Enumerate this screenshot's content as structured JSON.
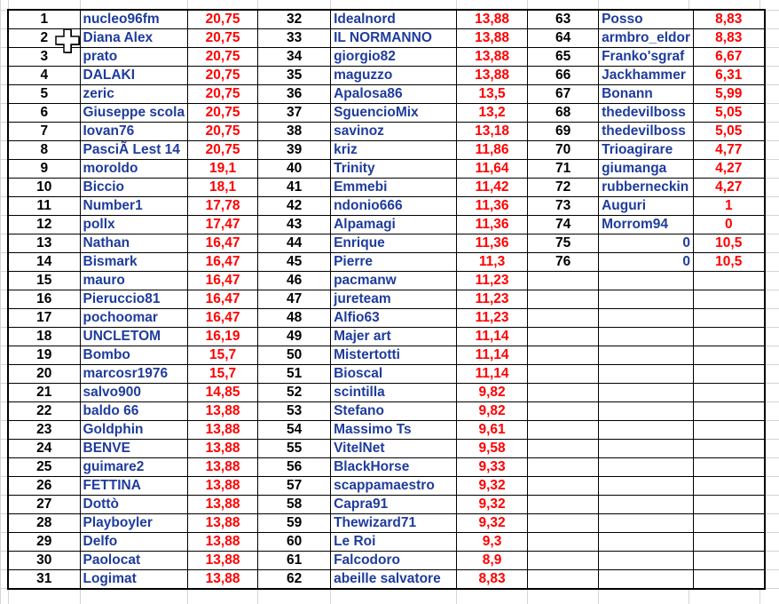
{
  "colors": {
    "rank": "#000000",
    "name": "#1f3c9c",
    "score": "#ff0000"
  },
  "cursor_icon": "excel-cell-select-cross-cursor",
  "groups": [
    [
      [
        "1",
        "nucleo96fm",
        "20,75"
      ],
      [
        "2",
        "Diana Alex",
        "20,75"
      ],
      [
        "3",
        "prato",
        "20,75"
      ],
      [
        "4",
        "DALAKI",
        "20,75"
      ],
      [
        "5",
        "zeric",
        "20,75"
      ],
      [
        "6",
        "Giuseppe scola",
        "20,75"
      ],
      [
        "7",
        "Iovan76",
        "20,75"
      ],
      [
        "8",
        "PasciÃ  Lest 14",
        "20,75"
      ],
      [
        "9",
        "moroldo",
        "19,1"
      ],
      [
        "10",
        "Biccio",
        "18,1"
      ],
      [
        "11",
        "Number1",
        "17,78"
      ],
      [
        "12",
        "pollx",
        "17,47"
      ],
      [
        "13",
        "Nathan",
        "16,47"
      ],
      [
        "14",
        "Bismark",
        "16,47"
      ],
      [
        "15",
        "mauro",
        "16,47"
      ],
      [
        "16",
        "Pieruccio81",
        "16,47"
      ],
      [
        "17",
        "pochoomar",
        "16,47"
      ],
      [
        "18",
        "UNCLETOM",
        "16,19"
      ],
      [
        "19",
        "Bombo",
        "15,7"
      ],
      [
        "20",
        "marcosr1976",
        "15,7"
      ],
      [
        "21",
        "salvo900",
        "14,85"
      ],
      [
        "22",
        "baldo 66",
        "13,88"
      ],
      [
        "23",
        "Goldphin",
        "13,88"
      ],
      [
        "24",
        "BENVE",
        "13,88"
      ],
      [
        "25",
        "guimare2",
        "13,88"
      ],
      [
        "26",
        "FETTINA",
        "13,88"
      ],
      [
        "27",
        "Dottò",
        "13,88"
      ],
      [
        "28",
        "Playboyler",
        "13,88"
      ],
      [
        "29",
        "Delfo",
        "13,88"
      ],
      [
        "30",
        "Paolocat",
        "13,88"
      ],
      [
        "31",
        "Logimat",
        "13,88"
      ]
    ],
    [
      [
        "32",
        "Idealnord",
        "13,88"
      ],
      [
        "33",
        "IL NORMANNO",
        "13,88"
      ],
      [
        "34",
        "giorgio82",
        "13,88"
      ],
      [
        "35",
        "maguzzo",
        "13,88"
      ],
      [
        "36",
        "Apalosa86",
        "13,5"
      ],
      [
        "37",
        "SguencioMix",
        "13,2"
      ],
      [
        "38",
        "savinoz",
        "13,18"
      ],
      [
        "39",
        "kriz",
        "11,86"
      ],
      [
        "40",
        "Trinity",
        "11,64"
      ],
      [
        "41",
        "Emmebi",
        "11,42"
      ],
      [
        "42",
        "ndonio666",
        "11,36"
      ],
      [
        "43",
        "Alpamagi",
        "11,36"
      ],
      [
        "44",
        "Enrique",
        "11,36"
      ],
      [
        "45",
        "Pierre",
        "11,3"
      ],
      [
        "46",
        "pacmanw",
        "11,23"
      ],
      [
        "47",
        "jureteam",
        "11,23"
      ],
      [
        "48",
        "Alfio63",
        "11,23"
      ],
      [
        "49",
        "Majer art",
        "11,14"
      ],
      [
        "50",
        "Mistertotti",
        "11,14"
      ],
      [
        "51",
        "Bioscal",
        "11,14"
      ],
      [
        "52",
        "scintilla",
        "9,82"
      ],
      [
        "53",
        "Stefano",
        "9,82"
      ],
      [
        "54",
        "Massimo Ts",
        "9,61"
      ],
      [
        "55",
        "VitelNet",
        "9,58"
      ],
      [
        "56",
        "BlackHorse",
        "9,33"
      ],
      [
        "57",
        "scappamaestro",
        "9,32"
      ],
      [
        "58",
        "Capra91",
        "9,32"
      ],
      [
        "59",
        "Thewizard71",
        "9,32"
      ],
      [
        "60",
        "Le Roi",
        "9,3"
      ],
      [
        "61",
        "Falcodoro",
        "8,9"
      ],
      [
        "62",
        "abeille salvatore",
        "8,83"
      ]
    ],
    [
      [
        "63",
        "Posso",
        "8,83"
      ],
      [
        "64",
        "armbro_eldor",
        "8,83"
      ],
      [
        "65",
        "Franko'sgraf",
        "6,67"
      ],
      [
        "66",
        "Jackhammer",
        "6,31"
      ],
      [
        "67",
        "Bonann",
        "5,99"
      ],
      [
        "68",
        "thedevilboss",
        "5,05"
      ],
      [
        "69",
        "thedevilboss",
        "5,05"
      ],
      [
        "70",
        "Trioagirare",
        "4,77"
      ],
      [
        "71",
        "giumanga",
        "4,27"
      ],
      [
        "72",
        "rubberneckin",
        "4,27"
      ],
      [
        "73",
        "Auguri",
        "1"
      ],
      [
        "74",
        "Morrom94",
        "0"
      ],
      [
        "75",
        "0",
        "10,5"
      ],
      [
        "76",
        "0",
        "10,5"
      ]
    ]
  ]
}
